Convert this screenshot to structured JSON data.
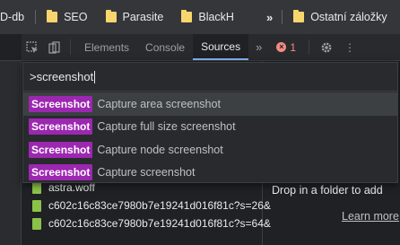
{
  "bookmarks": {
    "items": [
      {
        "label": "D-db",
        "has_folder": false
      },
      {
        "label": "SEO",
        "has_folder": true
      },
      {
        "label": "Parasite",
        "has_folder": true
      },
      {
        "label": "BlackH",
        "has_folder": true
      }
    ],
    "more_label": "»",
    "other_label": "Ostatní záložky"
  },
  "devtools": {
    "tabs": [
      "Elements",
      "Console",
      "Sources"
    ],
    "active_tab": "Sources",
    "more_tabs": "»",
    "error_count": "1",
    "menu_dots": "⋮",
    "colors": {
      "accent": "#8ab4f8",
      "error": "#f28b82",
      "badge": "#9c27b0"
    }
  },
  "command_menu": {
    "query": ">screenshot",
    "items": [
      {
        "badge": "Screenshot",
        "label": "Capture area screenshot",
        "selected": true
      },
      {
        "badge": "Screenshot",
        "label": "Capture full size screenshot",
        "selected": false
      },
      {
        "badge": "Screenshot",
        "label": "Capture node screenshot",
        "selected": false
      },
      {
        "badge": "Screenshot",
        "label": "Capture screenshot",
        "selected": false
      }
    ]
  },
  "files": [
    {
      "name": "astra.woff",
      "icon": "font-file-icon"
    },
    {
      "name": "c602c16c83ce7980b7e19241d016f81c?s=26&",
      "icon": "image-file-icon"
    },
    {
      "name": "c602c16c83ce7980b7e19241d016f81c?s=64&",
      "icon": "image-file-icon"
    }
  ],
  "editor": {
    "drop_text": "Drop in a folder to add",
    "learn_more": "Learn more"
  }
}
